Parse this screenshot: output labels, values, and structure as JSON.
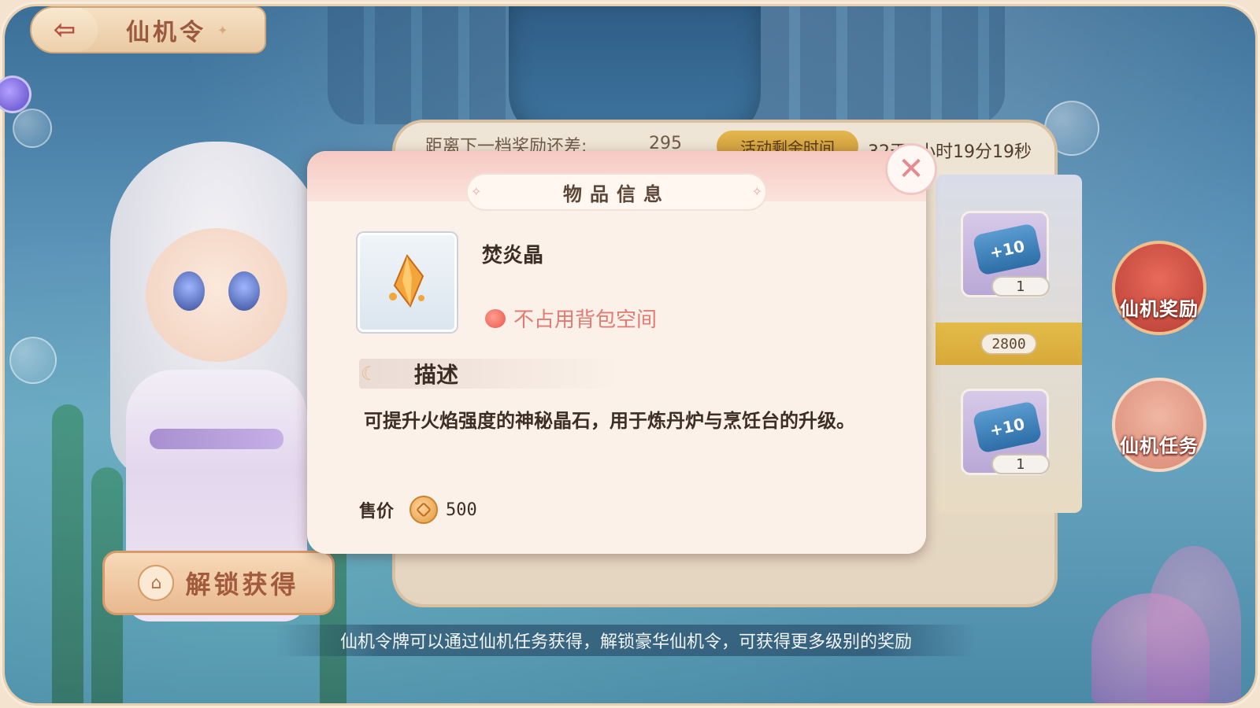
{
  "header": {
    "back_icon": "back-arrow-icon",
    "title": "仙机令"
  },
  "progress_bar": {
    "next_reward_label": "距离下一档奖励还差:",
    "next_reward_value": "295",
    "time_badge": "活动剩余时间",
    "time_remaining": "32天1小时19分19秒"
  },
  "reward_column": {
    "level_badge": "2800",
    "cards": [
      {
        "icon": "scroll-plus10-icon",
        "scroll_text": "+10",
        "count": "1"
      },
      {
        "icon": "scroll-plus10-icon",
        "scroll_text": "+10",
        "count": "1"
      }
    ]
  },
  "side_buttons": {
    "rewards": "仙机奖励",
    "tasks": "仙机任务"
  },
  "unlock_button": {
    "label": "解锁获得",
    "icon": "lock-icon"
  },
  "dialog": {
    "title": "物品信息",
    "item_name": "焚炎晶",
    "tag": "不占用背包空间",
    "desc_title": "描述",
    "description": "可提升火焰强度的神秘晶石，用于炼丹炉与烹饪台的升级。",
    "price_label": "售价",
    "price_value": "500",
    "close_icon": "close-icon"
  },
  "bottom_tip": "仙机令牌可以通过仙机任务获得，解锁豪华仙机令，可获得更多级别的奖励",
  "colors": {
    "accent_red": "#e27a72",
    "panel_bg": "#fbf1e8",
    "gold": "#e3b64d"
  }
}
